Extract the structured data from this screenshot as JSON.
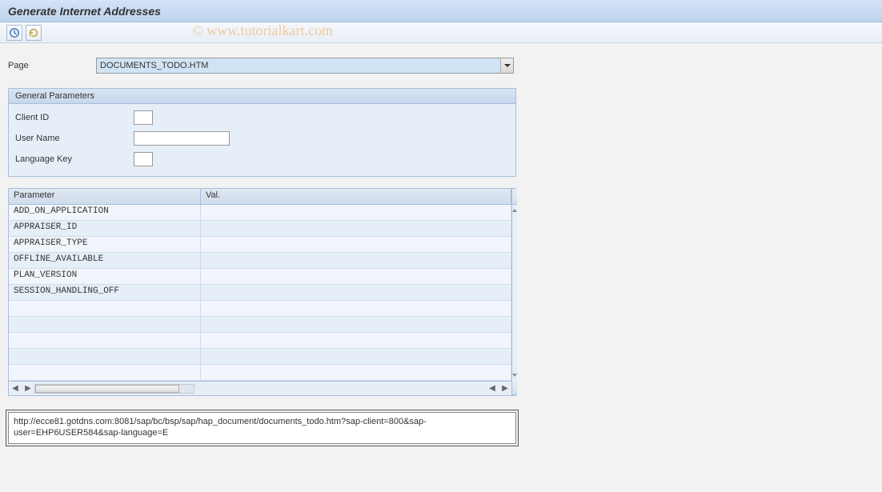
{
  "title": "Generate Internet Addresses",
  "watermark": "© www.tutorialkart.com",
  "page_field": {
    "label": "Page",
    "value": "DOCUMENTS_TODO.HTM"
  },
  "general": {
    "header": "General Parameters",
    "client_id_label": "Client ID",
    "client_id_value": "",
    "user_name_label": "User Name",
    "user_name_value": "",
    "language_key_label": "Language Key",
    "language_key_value": ""
  },
  "grid": {
    "col_param": "Parameter",
    "col_val": "Val.",
    "rows": [
      {
        "param": "ADD_ON_APPLICATION",
        "val": ""
      },
      {
        "param": "APPRAISER_ID",
        "val": ""
      },
      {
        "param": "APPRAISER_TYPE",
        "val": ""
      },
      {
        "param": "OFFLINE_AVAILABLE",
        "val": ""
      },
      {
        "param": "PLAN_VERSION",
        "val": ""
      },
      {
        "param": "SESSION_HANDLING_OFF",
        "val": ""
      },
      {
        "param": "",
        "val": ""
      },
      {
        "param": "",
        "val": ""
      },
      {
        "param": "",
        "val": ""
      },
      {
        "param": "",
        "val": ""
      },
      {
        "param": "",
        "val": ""
      }
    ]
  },
  "url": "http://ecce81.gotdns.com:8081/sap/bc/bsp/sap/hap_document/documents_todo.htm?sap-client=800&sap-user=EHP6USER584&sap-language=E"
}
